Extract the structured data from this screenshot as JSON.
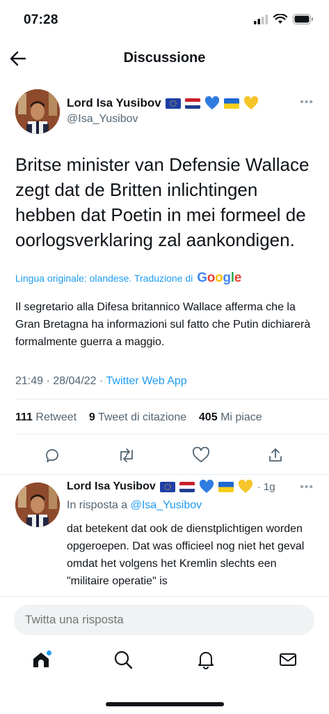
{
  "status_bar": {
    "time": "07:28"
  },
  "nav": {
    "title": "Discussione"
  },
  "main_tweet": {
    "author_name": "Lord Isa Yusibov",
    "handle": "@Isa_Yusibov",
    "text": "Britse minister van Defensie Wallace zegt dat de Britten inlichtingen hebben dat Poetin in mei formeel de oorlogsverklaring zal aankondigen.",
    "translation_label": "Lingua originale: olandese. Traduzione di",
    "translation_provider": "Google",
    "translated_text": "Il segretario alla Difesa britannico Wallace afferma che la Gran Bretagna ha informazioni sul fatto che Putin dichiarerà formalmente guerra a maggio.",
    "time": "21:49",
    "date": "28/04/22",
    "source_app": "Twitter Web App",
    "retweets": "111",
    "retweets_label": "Retweet",
    "quotes": "9",
    "quotes_label": "Tweet di citazione",
    "likes": "405",
    "likes_label": "Mi piace"
  },
  "reply_tweet": {
    "author_name": "Lord Isa Yusibov",
    "time_ago": "1g",
    "reply_to_label": "In risposta a",
    "reply_to_handle": "@Isa_Yusibov",
    "text": "dat betekent dat ook de dienstplichtigen worden opgeroepen. Dat was officieel nog niet het geval omdat het volgens het Kremlin slechts een \"militaire operatie\" is"
  },
  "reply_box": {
    "placeholder": "Twitta una risposta"
  },
  "tab_bar": {
    "items": [
      "home-icon",
      "search-icon",
      "notifications-icon",
      "messages-icon"
    ]
  },
  "colors": {
    "accent": "#1d9bf0",
    "text": "#0f1419",
    "secondary": "#536471"
  }
}
